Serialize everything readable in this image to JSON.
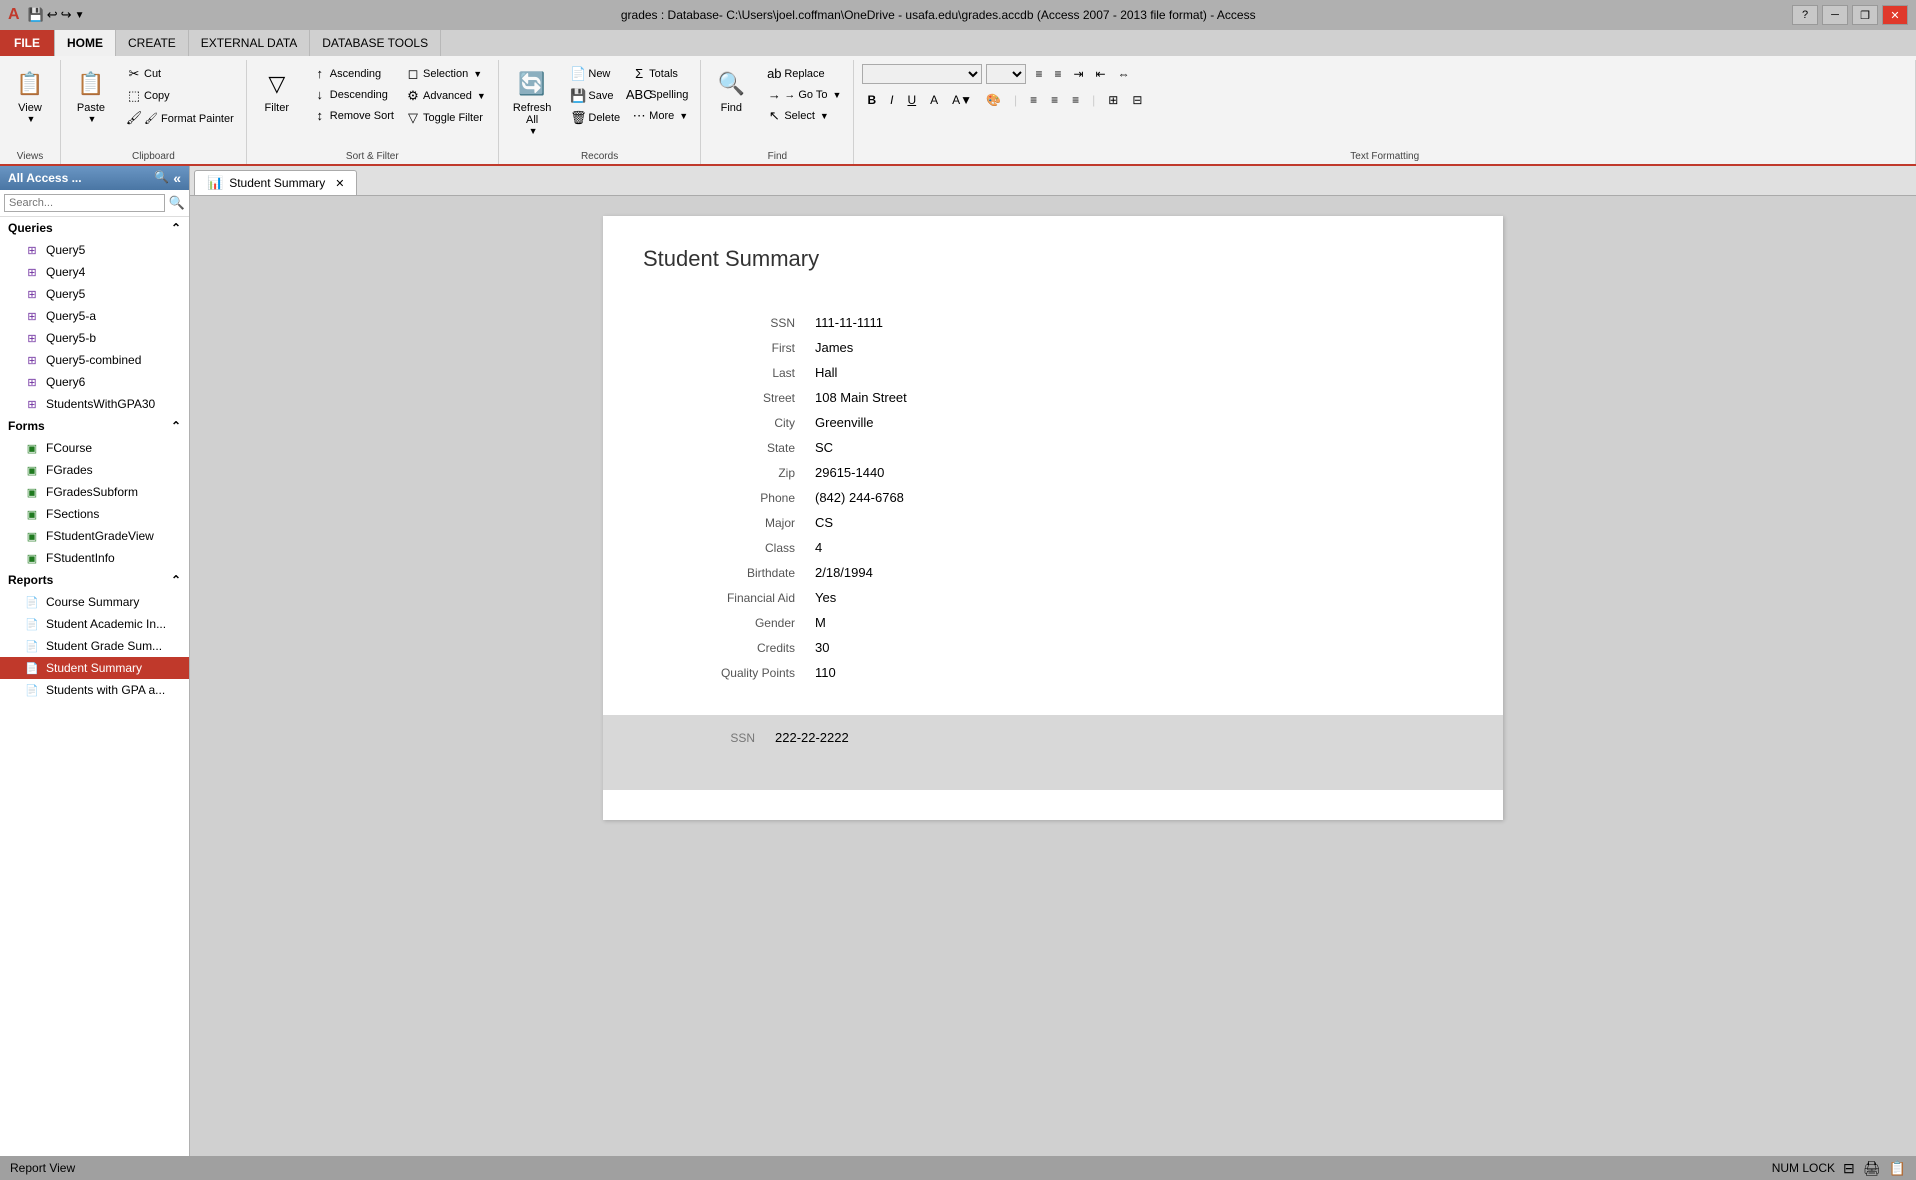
{
  "titlebar": {
    "title": "grades : Database- C:\\Users\\joel.coffman\\OneDrive - usafa.edu\\grades.accdb (Access 2007 - 2013 file format) - Access",
    "minimize_label": "─",
    "restore_label": "❐",
    "close_label": "✕",
    "help_label": "?"
  },
  "tabs": {
    "file": "FILE",
    "home": "HOME",
    "create": "CREATE",
    "external_data": "EXTERNAL DATA",
    "database_tools": "DATABASE TOOLS"
  },
  "ribbon": {
    "groups": {
      "views": {
        "label": "Views",
        "view_label": "View"
      },
      "clipboard": {
        "label": "Clipboard",
        "paste_label": "Paste",
        "cut_label": "✂ Cut",
        "copy_label": "⬚ Copy",
        "format_painter_label": "🖌 Format Painter"
      },
      "sort_filter": {
        "label": "Sort & Filter",
        "filter_label": "Filter",
        "ascending_label": "↑ Ascending",
        "descending_label": "↓ Descending",
        "remove_sort_label": "↕ Remove Sort",
        "selection_label": "Selection",
        "advanced_label": "Advanced",
        "toggle_filter_label": "Toggle Filter"
      },
      "records": {
        "label": "Records",
        "new_label": "New",
        "save_label": "Save",
        "delete_label": "Delete",
        "totals_label": "Totals",
        "spelling_label": "Spelling",
        "more_label": "More",
        "refresh_all_label": "Refresh\nAll"
      },
      "find": {
        "label": "Find",
        "find_label": "Find",
        "replace_label": "ab Replace",
        "goto_label": "→ Go To",
        "select_label": "Select"
      },
      "text_formatting": {
        "label": "Text Formatting"
      }
    }
  },
  "nav_panel": {
    "header": "All Access ...",
    "search_placeholder": "Search...",
    "queries_section": "Queries",
    "forms_section": "Forms",
    "reports_section": "Reports",
    "items": {
      "queries": [
        "Query5",
        "Query4",
        "Query5",
        "Query5-a",
        "Query5-b",
        "Query5-combined",
        "Query6",
        "StudentsWithGPA30"
      ],
      "forms": [
        "FCourse",
        "FGrades",
        "FGradesSubform",
        "FSections",
        "FStudentGradeView",
        "FStudentInfo"
      ],
      "reports": [
        "Course Summary",
        "Student Academic In...",
        "Student Grade Sum...",
        "Student Summary",
        "Students with GPA a..."
      ]
    }
  },
  "report": {
    "tab_label": "Student Summary",
    "title": "Student Summary",
    "record1": {
      "ssn_label": "SSN",
      "ssn_value": "111-11-1111",
      "first_label": "First",
      "first_value": "James",
      "last_label": "Last",
      "last_value": "Hall",
      "street_label": "Street",
      "street_value": "108 Main Street",
      "city_label": "City",
      "city_value": "Greenville",
      "state_label": "State",
      "state_value": "SC",
      "zip_label": "Zip",
      "zip_value": "29615-1440",
      "phone_label": "Phone",
      "phone_value": "(842) 244-6768",
      "major_label": "Major",
      "major_value": "CS",
      "class_label": "Class",
      "class_value": "4",
      "birthdate_label": "Birthdate",
      "birthdate_value": "2/18/1994",
      "financial_aid_label": "Financial Aid",
      "financial_aid_value": "Yes",
      "gender_label": "Gender",
      "gender_value": "M",
      "credits_label": "Credits",
      "credits_value": "30",
      "quality_points_label": "Quality Points",
      "quality_points_value": "110"
    },
    "record2": {
      "ssn_label": "SSN",
      "ssn_value": "222-22-2222"
    }
  },
  "statusbar": {
    "view_label": "Report View",
    "num_lock": "NUM LOCK",
    "icons": [
      "layout-view-icon",
      "print-preview-icon",
      "report-view-icon"
    ]
  }
}
